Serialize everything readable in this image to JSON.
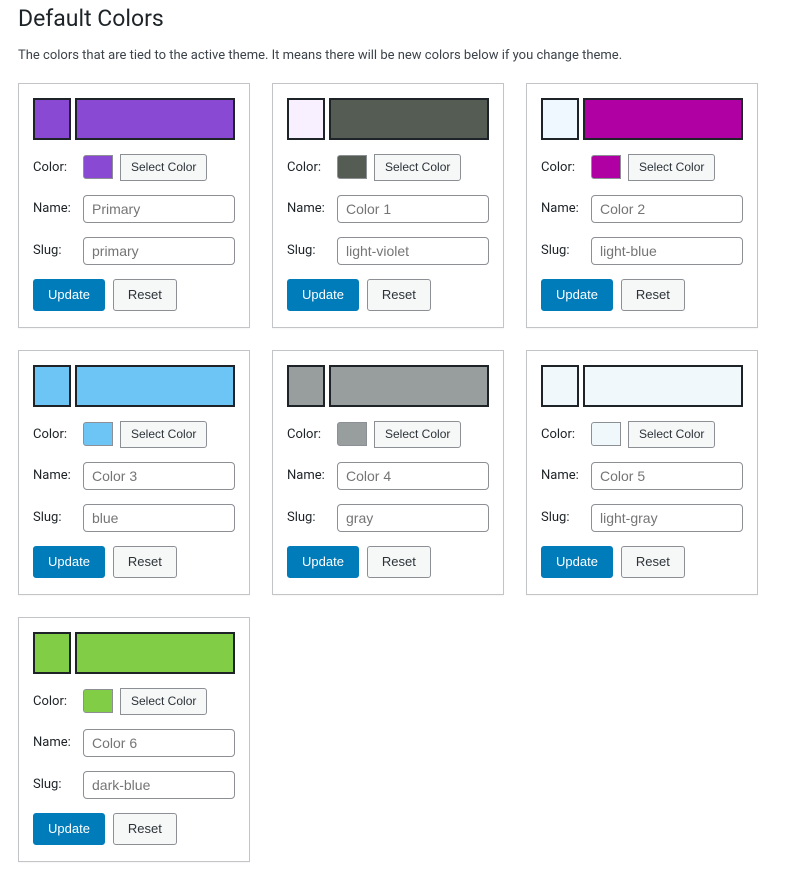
{
  "header": {
    "title": "Default Colors",
    "description": "The colors that are tied to the active theme. It means there will be new colors below if you change theme."
  },
  "labels": {
    "color": "Color:",
    "name": "Name:",
    "slug": "Slug:",
    "selectColor": "Select Color",
    "update": "Update",
    "reset": "Reset"
  },
  "items": [
    {
      "swatchSmall": "#8949d3",
      "swatchLarge": "#8949d3",
      "chip": "#8949d3",
      "namePlaceholder": "Primary",
      "slugPlaceholder": "primary"
    },
    {
      "swatchSmall": "#f8f0ff",
      "swatchLarge": "#555c53",
      "chip": "#555c53",
      "namePlaceholder": "Color 1",
      "slugPlaceholder": "light-violet"
    },
    {
      "swatchSmall": "#f0f8ff",
      "swatchLarge": "#b000a4",
      "chip": "#b000a4",
      "namePlaceholder": "Color 2",
      "slugPlaceholder": "light-blue"
    },
    {
      "swatchSmall": "#6cc5f4",
      "swatchLarge": "#6cc5f4",
      "chip": "#6cc5f4",
      "namePlaceholder": "Color 3",
      "slugPlaceholder": "blue"
    },
    {
      "swatchSmall": "#989e9e",
      "swatchLarge": "#989e9e",
      "chip": "#989e9e",
      "namePlaceholder": "Color 4",
      "slugPlaceholder": "gray"
    },
    {
      "swatchSmall": "#f0f8fc",
      "swatchLarge": "#f0f8fc",
      "chip": "#f0f8fc",
      "namePlaceholder": "Color 5",
      "slugPlaceholder": "light-gray"
    },
    {
      "swatchSmall": "#82cd46",
      "swatchLarge": "#82cd46",
      "chip": "#82cd46",
      "namePlaceholder": "Color 6",
      "slugPlaceholder": "dark-blue"
    }
  ]
}
